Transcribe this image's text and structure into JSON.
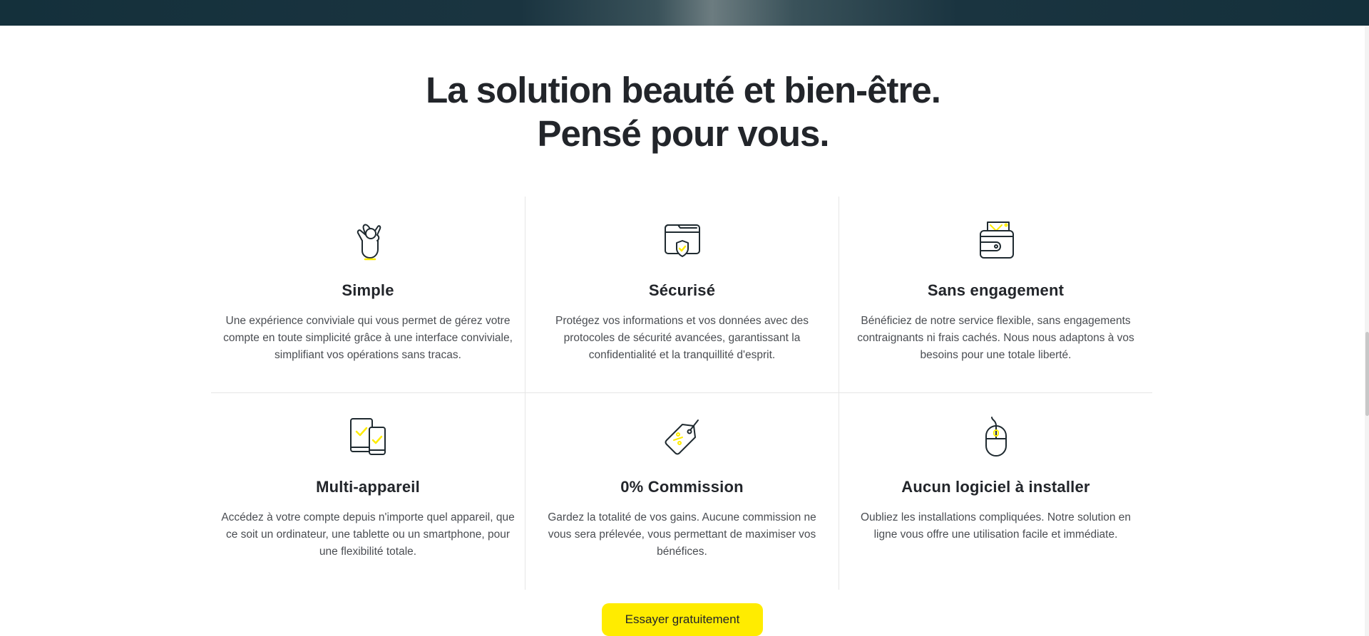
{
  "headline": {
    "line1": "La solution beauté et bien-être.",
    "line2": "Pensé pour vous."
  },
  "features": [
    {
      "icon": "ok-hand-icon",
      "title": "Simple",
      "text": "Une expérience conviviale qui vous permet de gérez votre compte en toute simplicité grâce à une interface conviviale, simplifiant vos opérations sans tracas."
    },
    {
      "icon": "secure-folder-shield-icon",
      "title": "Sécurisé",
      "text": "Protégez vos informations et vos données avec des protocoles de sécurité avancées, garantissant la confidentialité et la tranquillité d'esprit."
    },
    {
      "icon": "wallet-icon",
      "title": "Sans engagement",
      "text": "Bénéficiez de notre service flexible, sans engagements contraignants ni frais cachés. Nous nous adaptons à vos besoins pour une totale liberté."
    },
    {
      "icon": "multi-device-icon",
      "title": "Multi-appareil",
      "text": "Accédez à votre compte depuis n'importe quel appareil, que ce soit un ordinateur, une tablette ou un smartphone, pour une flexibilité totale."
    },
    {
      "icon": "price-tag-icon",
      "title": "0% Commission",
      "text": "Gardez la totalité de vos gains. Aucune commission ne vous sera prélevée, vous permettant de maximiser vos bénéfices."
    },
    {
      "icon": "mouse-icon",
      "title": "Aucun logiciel à installer",
      "text": "Oubliez les installations compliquées. Notre solution en ligne vous offre une utilisation facile et immédiate."
    }
  ],
  "cta": {
    "label": "Essayer gratuitement"
  },
  "colors": {
    "accent": "#ffec00",
    "dark": "#22252a",
    "banner": "#14303b"
  }
}
